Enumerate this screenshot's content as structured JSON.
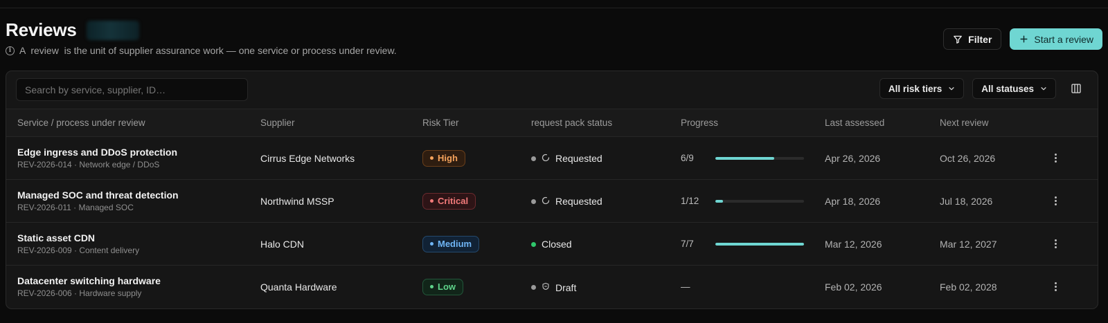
{
  "page": {
    "title": "Reviews",
    "subtitle": "A  review  is the unit of supplier assurance work — one service or process under review.",
    "actions": {
      "filter_label": "Filter",
      "start_label": "Start a review"
    }
  },
  "toolbar": {
    "search_placeholder": "Search by service, supplier, ID…",
    "risk_filter": "All risk tiers",
    "status_filter": "All statuses"
  },
  "table": {
    "columns": [
      "Service / process under review",
      "Supplier",
      "Risk Tier",
      "request pack status",
      "Progress",
      "Last assessed",
      "Next review"
    ],
    "rows": [
      {
        "name": "Edge ingress and DDoS protection",
        "meta": "REV-2026-014 · Network edge / DDoS",
        "supplier": "Cirrus Edge Networks",
        "risk": "High",
        "status": "Requested",
        "status_icon": "pending-spinner-icon",
        "progress": "6/9",
        "progress_ratio": 0.667,
        "last": "Apr 26, 2026",
        "next": "Oct 26, 2026"
      },
      {
        "name": "Managed SOC and threat detection",
        "meta": "REV-2026-011 · Managed SOC",
        "supplier": "Northwind MSSP",
        "risk": "Critical",
        "status": "Requested",
        "status_icon": "pending-spinner-icon",
        "progress": "1/12",
        "progress_ratio": 0.083,
        "last": "Apr 18, 2026",
        "next": "Jul 18, 2026"
      },
      {
        "name": "Static asset CDN",
        "meta": "REV-2026-009 · Content delivery",
        "supplier": "Halo CDN",
        "risk": "Medium",
        "status": "Closed",
        "status_icon": "",
        "progress": "7/7",
        "progress_ratio": 1.0,
        "last": "Mar 12, 2026",
        "next": "Mar 12, 2027"
      },
      {
        "name": "Datacenter switching hardware",
        "meta": "REV-2026-006 · Hardware supply",
        "supplier": "Quanta Hardware",
        "risk": "Low",
        "status": "Draft",
        "status_icon": "draft-shield-icon",
        "progress": "—",
        "progress_ratio": null,
        "last": "Feb 02, 2026",
        "next": "Feb 02, 2028"
      }
    ]
  },
  "colors": {
    "accent": "#6fd6d2",
    "risk": {
      "High": {
        "fg": "#f5a35c",
        "bg": "#2e1d10",
        "border": "#6a3f1a"
      },
      "Critical": {
        "fg": "#f27a7a",
        "bg": "#2d1416",
        "border": "#6b2a2e"
      },
      "Medium": {
        "fg": "#6fb5f5",
        "bg": "#112235",
        "border": "#24496d"
      },
      "Low": {
        "fg": "#5fd38a",
        "bg": "#112519",
        "border": "#22573a"
      }
    },
    "status_dot": {
      "Requested": "#9a9a9a",
      "Closed": "#2fc76b",
      "Draft": "#9a9a9a"
    }
  }
}
